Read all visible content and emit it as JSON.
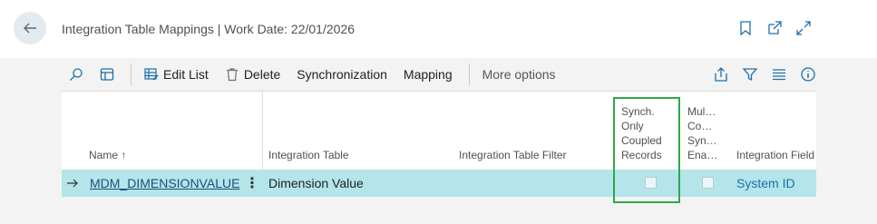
{
  "header": {
    "title": "Integration Table Mappings | Work Date: 22/01/2026"
  },
  "actions": {
    "edit_list": "Edit List",
    "delete": "Delete",
    "synchronization": "Synchronization",
    "mapping": "Mapping",
    "more_options": "More options"
  },
  "table": {
    "columns": {
      "name": "Name ↑",
      "integration_table": "Integration Table",
      "integration_table_filter": "Integration Table Filter",
      "synch_only_coupled": [
        "Synch.",
        "Only",
        "Coupled",
        "Records"
      ],
      "multi_company": [
        "Mul…",
        "Co…",
        "Syn…",
        "Ena…"
      ],
      "integration_field": "Integration Field"
    },
    "rows": [
      {
        "name": "MDM_DIMENSIONVALUE",
        "integration_table": "Dimension Value",
        "integration_table_filter": "",
        "synch_only_coupled": false,
        "multi_company": false,
        "integration_field": "System ID"
      }
    ]
  },
  "colors": {
    "highlight": "#2da84a",
    "selected_row": "#b3e5ea",
    "accent": "#1e6fa8"
  }
}
